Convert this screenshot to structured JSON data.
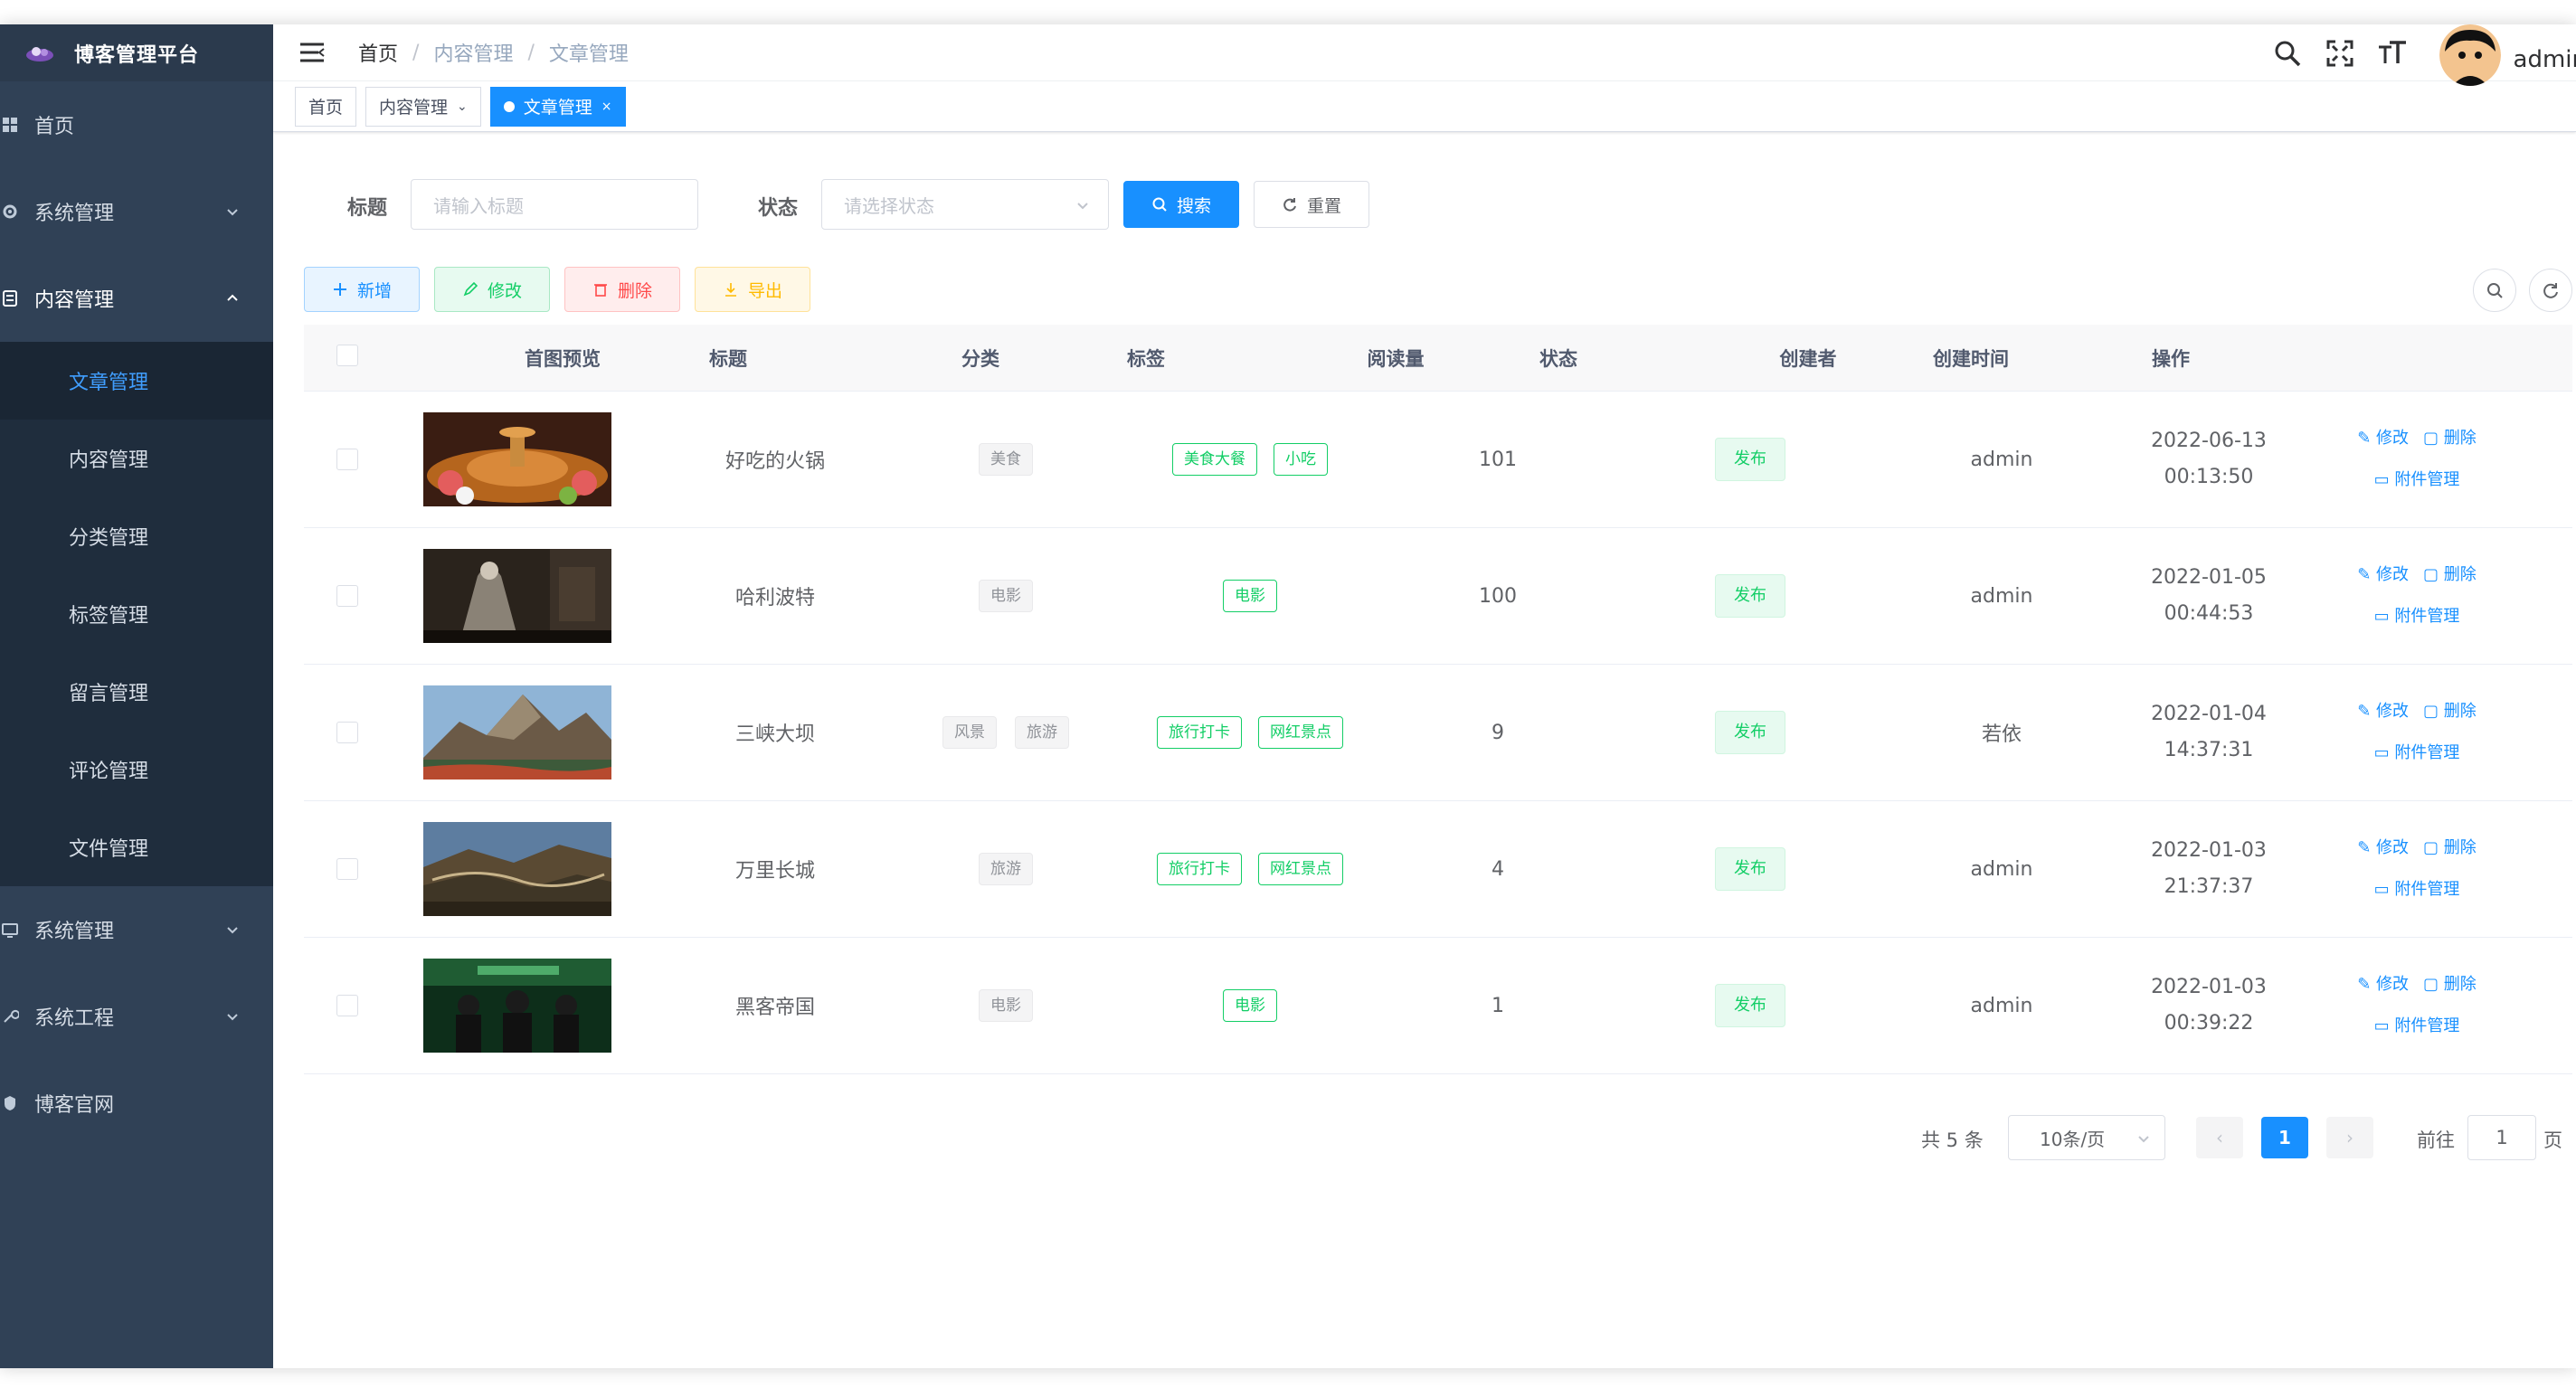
{
  "app": {
    "title": "博客管理平台",
    "user": "admin"
  },
  "sidebar": {
    "items": [
      {
        "label": "首页",
        "icon": "dashboard-icon"
      },
      {
        "label": "系统管理",
        "icon": "gear-icon"
      },
      {
        "label": "内容管理",
        "icon": "content-icon"
      }
    ],
    "sub": [
      {
        "label": "文章管理",
        "active": true
      },
      {
        "label": "内容管理"
      },
      {
        "label": "分类管理"
      },
      {
        "label": "标签管理"
      },
      {
        "label": "留言管理"
      },
      {
        "label": "评论管理"
      },
      {
        "label": "文件管理"
      }
    ],
    "bottom": [
      {
        "label": "系统管理",
        "icon": "system-icon"
      },
      {
        "label": "系统工程",
        "icon": "tool-icon"
      },
      {
        "label": "博客官网",
        "icon": "link-icon"
      }
    ]
  },
  "breadcrumb": [
    "首页",
    "内容管理",
    "文章管理"
  ],
  "tags_view": [
    {
      "label": "首页"
    },
    {
      "label": "内容管理",
      "close": "⌄"
    },
    {
      "label": "文章管理",
      "close": "×",
      "active": true
    }
  ],
  "search": {
    "title_label": "标题",
    "title_placeholder": "请输入标题",
    "status_label": "状态",
    "status_placeholder": "请选择状态",
    "search_btn": "搜索",
    "reset_btn": "重置"
  },
  "toolbar": {
    "add": "新增",
    "edit": "修改",
    "delete": "删除",
    "export": "导出"
  },
  "table": {
    "headers": [
      "首图预览",
      "标题",
      "分类",
      "标签",
      "阅读量",
      "状态",
      "创建者",
      "创建时间",
      "操作"
    ],
    "rows": [
      {
        "title": "好吃的火锅",
        "categories": [
          "美食"
        ],
        "tags": [
          "美食大餐",
          "小吃"
        ],
        "reads": "101",
        "status": "发布",
        "creator": "admin",
        "date": "2022-06-13",
        "time": "00:13:50",
        "thumb": "hotpot"
      },
      {
        "title": "哈利波特",
        "categories": [
          "电影"
        ],
        "tags": [
          "电影"
        ],
        "reads": "100",
        "status": "发布",
        "creator": "admin",
        "date": "2022-01-05",
        "time": "00:44:53",
        "thumb": "harry"
      },
      {
        "title": "三峡大坝",
        "categories": [
          "风景",
          "旅游"
        ],
        "tags": [
          "旅行打卡",
          "网红景点"
        ],
        "reads": "9",
        "status": "发布",
        "creator": "若依",
        "date": "2022-01-04",
        "time": "14:37:31",
        "thumb": "mountain"
      },
      {
        "title": "万里长城",
        "categories": [
          "旅游"
        ],
        "tags": [
          "旅行打卡",
          "网红景点"
        ],
        "reads": "4",
        "status": "发布",
        "creator": "admin",
        "date": "2022-01-03",
        "time": "21:37:37",
        "thumb": "wall"
      },
      {
        "title": "黑客帝国",
        "categories": [
          "电影"
        ],
        "tags": [
          "电影"
        ],
        "reads": "1",
        "status": "发布",
        "creator": "admin",
        "date": "2022-01-03",
        "time": "00:39:22",
        "thumb": "matrix"
      }
    ],
    "op_edit": "修改",
    "op_delete": "删除",
    "op_attach": "附件管理"
  },
  "pagination": {
    "total": "共 5 条",
    "page_size": "10条/页",
    "current": "1",
    "prev": "‹",
    "next": "›",
    "jump_label": "前往",
    "jump_value": "1",
    "page_suffix": "页"
  },
  "colors": {
    "sidebar_bg": "#304156",
    "submenu_bg": "#1f2d3d",
    "primary": "#1890ff",
    "success": "#13ce66",
    "danger": "#ff4949",
    "warning": "#ffba00"
  }
}
